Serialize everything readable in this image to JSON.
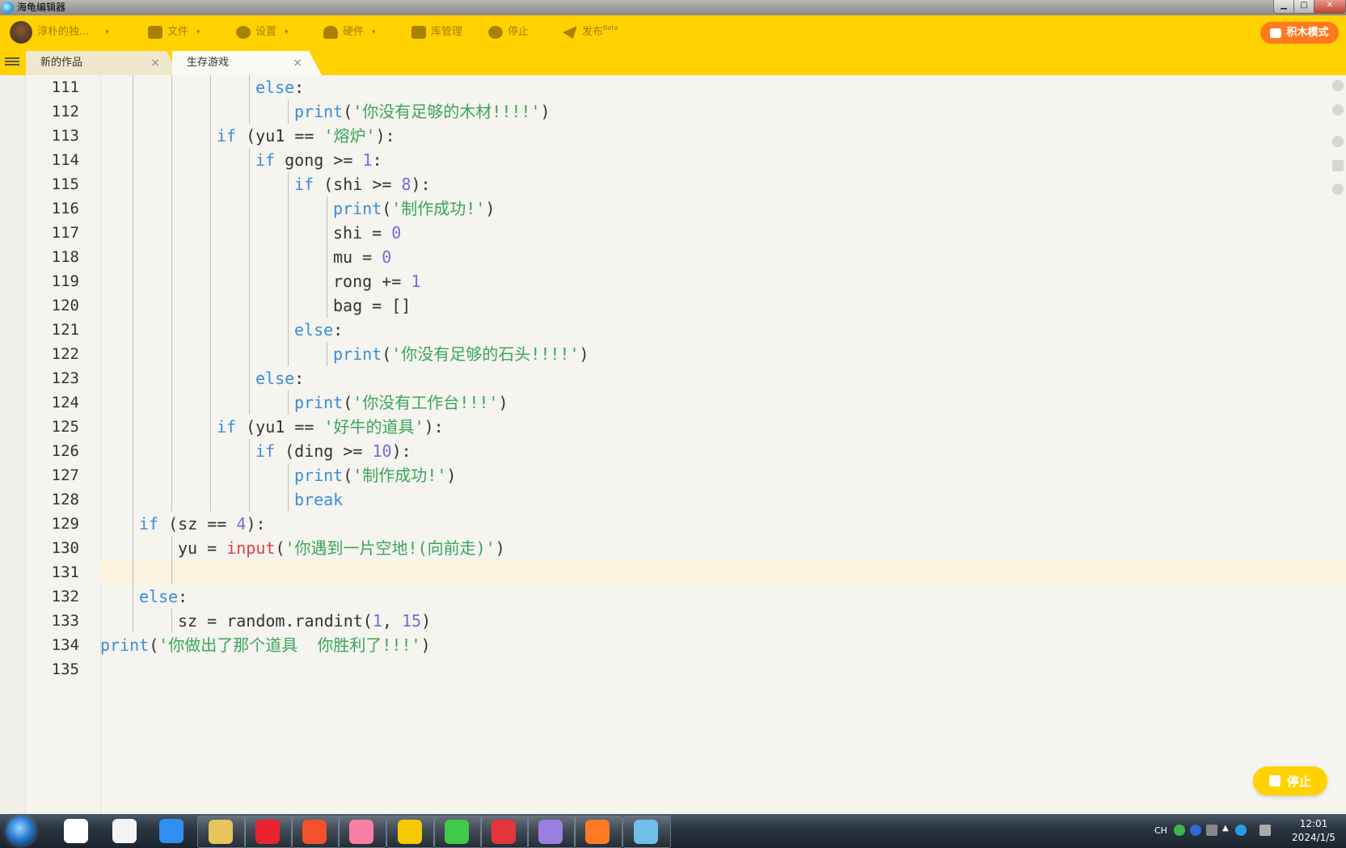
{
  "window": {
    "title": "海龟编辑器",
    "min_label": "▁",
    "max_label": "▢",
    "close_label": "✕"
  },
  "toolbar": {
    "user_name": "淳朴的独...",
    "file_label": "文件",
    "settings_label": "设置",
    "hardware_label": "硬件",
    "library_label": "库管理",
    "stop_label": "停止",
    "publish_label": "发布",
    "publish_badge": "Beta",
    "mode_label": "积木模式",
    "caret": "▾"
  },
  "tabs": [
    {
      "label": "新的作品",
      "close": "×"
    },
    {
      "label": "生存游戏",
      "close": "×"
    }
  ],
  "editor": {
    "current_line": 131,
    "lines": [
      {
        "n": "111",
        "indent": 4,
        "tokens": [
          [
            "kw",
            "else"
          ],
          [
            "plain",
            ":"
          ]
        ]
      },
      {
        "n": "112",
        "indent": 5,
        "tokens": [
          [
            "fn-builtin",
            "print"
          ],
          [
            "plain",
            "("
          ],
          [
            "str",
            "'你没有足够的木材!!!!'"
          ],
          [
            "plain",
            ")"
          ]
        ]
      },
      {
        "n": "113",
        "indent": 3,
        "tokens": [
          [
            "kw",
            "if"
          ],
          [
            "plain",
            " (yu1 == "
          ],
          [
            "str",
            "'熔炉'"
          ],
          [
            "plain",
            "):"
          ]
        ]
      },
      {
        "n": "114",
        "indent": 4,
        "tokens": [
          [
            "kw",
            "if"
          ],
          [
            "plain",
            " gong >= "
          ],
          [
            "num",
            "1"
          ],
          [
            "plain",
            ":"
          ]
        ]
      },
      {
        "n": "115",
        "indent": 5,
        "tokens": [
          [
            "kw",
            "if"
          ],
          [
            "plain",
            " (shi >= "
          ],
          [
            "num",
            "8"
          ],
          [
            "plain",
            "):"
          ]
        ]
      },
      {
        "n": "116",
        "indent": 6,
        "tokens": [
          [
            "fn-builtin",
            "print"
          ],
          [
            "plain",
            "("
          ],
          [
            "str",
            "'制作成功!'"
          ],
          [
            "plain",
            ")"
          ]
        ]
      },
      {
        "n": "117",
        "indent": 6,
        "tokens": [
          [
            "plain",
            "shi = "
          ],
          [
            "num",
            "0"
          ]
        ]
      },
      {
        "n": "118",
        "indent": 6,
        "tokens": [
          [
            "plain",
            "mu = "
          ],
          [
            "num",
            "0"
          ]
        ]
      },
      {
        "n": "119",
        "indent": 6,
        "tokens": [
          [
            "plain",
            "rong += "
          ],
          [
            "num",
            "1"
          ]
        ]
      },
      {
        "n": "120",
        "indent": 6,
        "tokens": [
          [
            "plain",
            "bag = []"
          ]
        ]
      },
      {
        "n": "121",
        "indent": 5,
        "tokens": [
          [
            "kw",
            "else"
          ],
          [
            "plain",
            ":"
          ]
        ]
      },
      {
        "n": "122",
        "indent": 6,
        "tokens": [
          [
            "fn-builtin",
            "print"
          ],
          [
            "plain",
            "("
          ],
          [
            "str",
            "'你没有足够的石头!!!!'"
          ],
          [
            "plain",
            ")"
          ]
        ]
      },
      {
        "n": "123",
        "indent": 4,
        "tokens": [
          [
            "kw",
            "else"
          ],
          [
            "plain",
            ":"
          ]
        ]
      },
      {
        "n": "124",
        "indent": 5,
        "tokens": [
          [
            "fn-builtin",
            "print"
          ],
          [
            "plain",
            "("
          ],
          [
            "str",
            "'你没有工作台!!!'"
          ],
          [
            "plain",
            ")"
          ]
        ]
      },
      {
        "n": "125",
        "indent": 3,
        "tokens": [
          [
            "kw",
            "if"
          ],
          [
            "plain",
            " (yu1 == "
          ],
          [
            "str",
            "'好牛的道具'"
          ],
          [
            "plain",
            "):"
          ]
        ]
      },
      {
        "n": "126",
        "indent": 4,
        "tokens": [
          [
            "kw",
            "if"
          ],
          [
            "plain",
            " (ding >= "
          ],
          [
            "num",
            "10"
          ],
          [
            "plain",
            "):"
          ]
        ]
      },
      {
        "n": "127",
        "indent": 5,
        "tokens": [
          [
            "fn-builtin",
            "print"
          ],
          [
            "plain",
            "("
          ],
          [
            "str",
            "'制作成功!'"
          ],
          [
            "plain",
            ")"
          ]
        ]
      },
      {
        "n": "128",
        "indent": 5,
        "tokens": [
          [
            "kw",
            "break"
          ]
        ]
      },
      {
        "n": "129",
        "indent": 1,
        "tokens": [
          [
            "kw",
            "if"
          ],
          [
            "plain",
            " (sz == "
          ],
          [
            "num",
            "4"
          ],
          [
            "plain",
            "):"
          ]
        ]
      },
      {
        "n": "130",
        "indent": 2,
        "tokens": [
          [
            "plain",
            "yu = "
          ],
          [
            "fn-input",
            "input"
          ],
          [
            "plain",
            "("
          ],
          [
            "str",
            "'你遇到一片空地!(向前走)'"
          ],
          [
            "plain",
            ")"
          ]
        ]
      },
      {
        "n": "131",
        "indent": 2,
        "tokens": []
      },
      {
        "n": "132",
        "indent": 1,
        "tokens": [
          [
            "kw",
            "else"
          ],
          [
            "plain",
            ":"
          ]
        ]
      },
      {
        "n": "133",
        "indent": 2,
        "tokens": [
          [
            "plain",
            "sz = random.randint("
          ],
          [
            "num",
            "1"
          ],
          [
            "plain",
            ", "
          ],
          [
            "num",
            "15"
          ],
          [
            "plain",
            ")"
          ]
        ]
      },
      {
        "n": "134",
        "indent": 0,
        "tokens": [
          [
            "fn-builtin",
            "print"
          ],
          [
            "plain",
            "("
          ],
          [
            "str",
            "'你做出了那个道具  你胜利了!!!'"
          ],
          [
            "plain",
            ")"
          ]
        ]
      },
      {
        "n": "135",
        "indent": 0,
        "tokens": []
      }
    ]
  },
  "float_stop": {
    "label": "停止"
  },
  "taskbar": {
    "apps": [
      "baidu-netdisk",
      "notepad",
      "feishu",
      "file-explorer",
      "netease-music",
      "wps-presentation",
      "bilibili",
      "qq-remote",
      "wechat",
      "app-red",
      "kite-app",
      "firefox",
      "turtle-editor"
    ],
    "tray_lang": "CH",
    "time": "12:01",
    "date": "2024/1/5"
  },
  "colors": {
    "toolbar_bg": "#ffd200",
    "keyword": "#3d8bd9",
    "string": "#3aa55a",
    "number": "#7a6ad8",
    "input_fn": "#e04040",
    "mode_button": "#ff7a1f"
  }
}
